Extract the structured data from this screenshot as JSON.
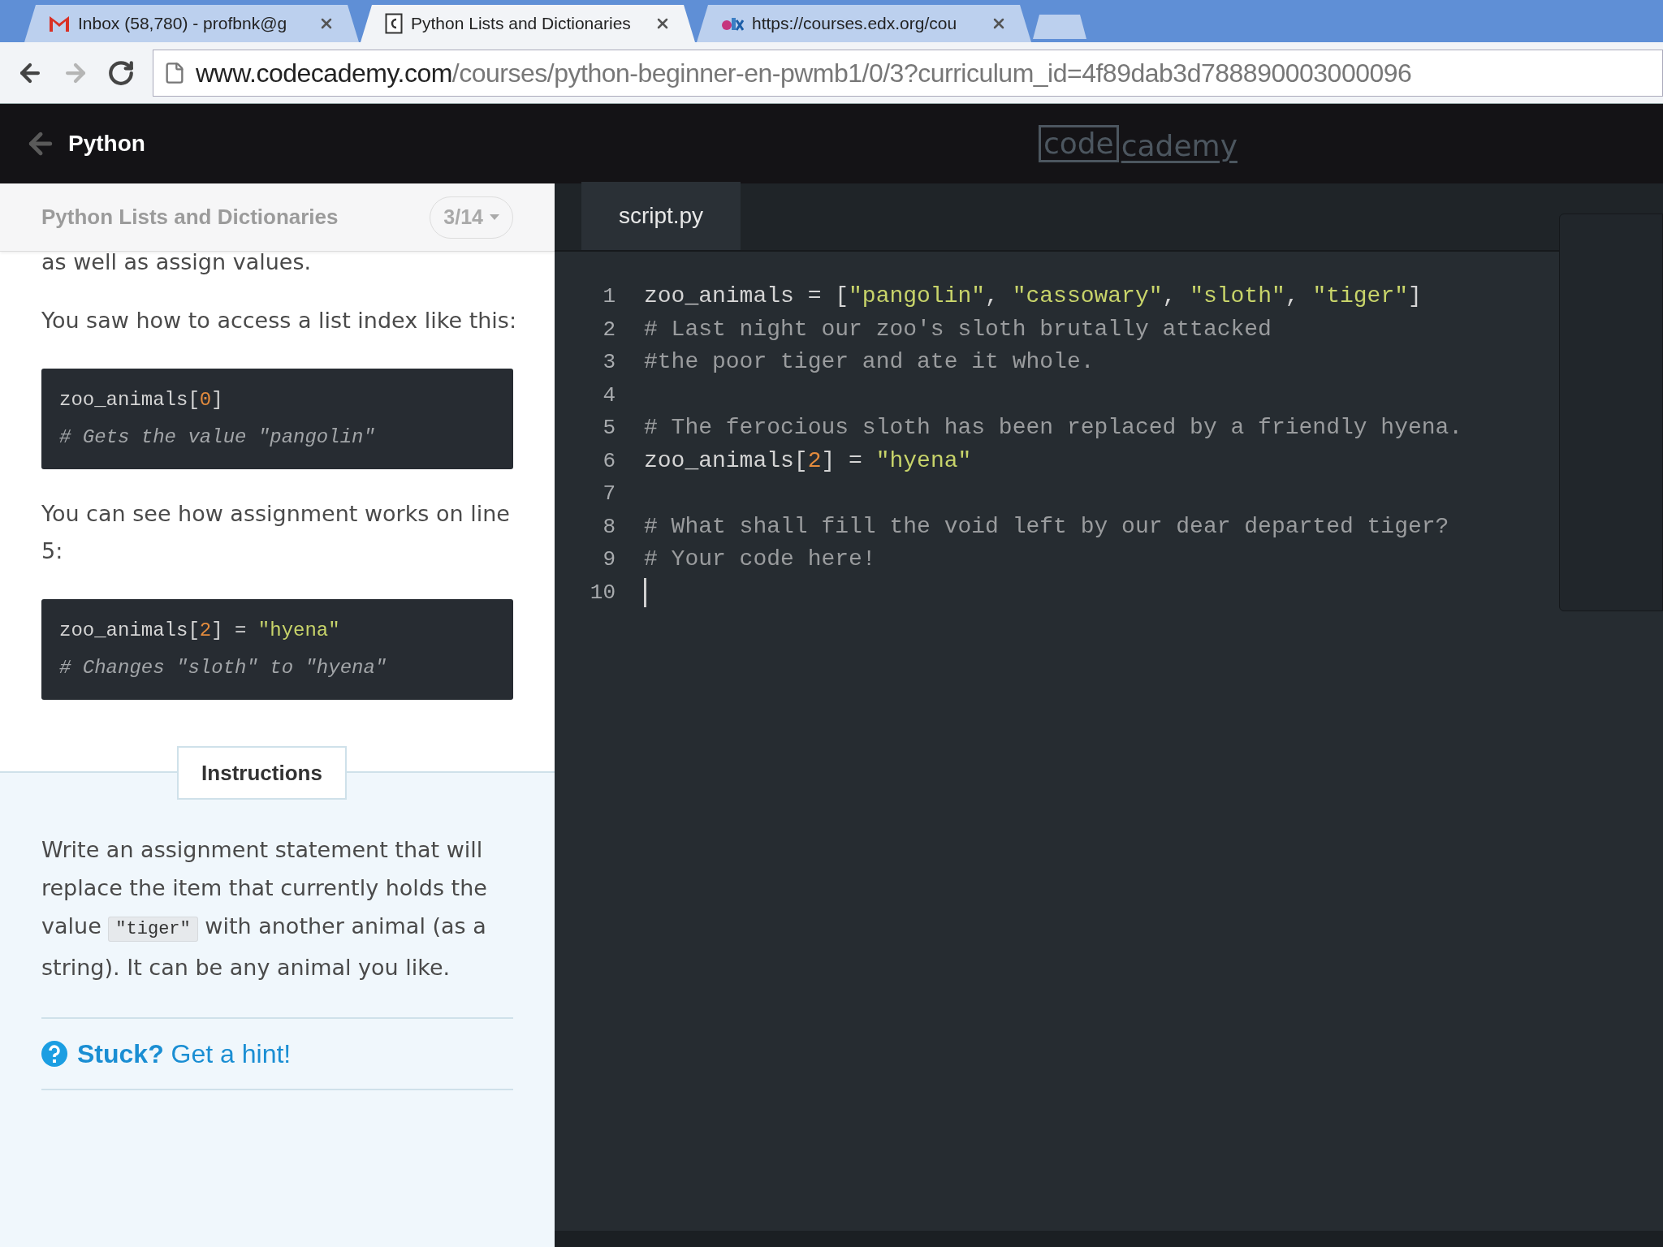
{
  "browser": {
    "tabs": [
      {
        "title": "Inbox (58,780) - profbnk@g",
        "kind": "mail",
        "selected": false
      },
      {
        "title": "Python Lists and Dictionaries",
        "kind": "page",
        "selected": true
      },
      {
        "title": "https://courses.edx.org/cou",
        "kind": "edx",
        "selected": false
      }
    ],
    "address": {
      "host": "www.codecademy.com",
      "path": "/courses/python-beginner-en-pwmb1/0/3?curriculum_id=4f89dab3d788890003000096"
    }
  },
  "header": {
    "course": "Python",
    "logo": {
      "boxed": "code",
      "rest": "cademy"
    }
  },
  "lesson": {
    "title": "Python Lists and Dictionaries",
    "progress": "3/14",
    "content": [
      {
        "kind": "cut",
        "text": "as well as assign values."
      },
      {
        "kind": "text",
        "text": "You saw how to access a list index like this:"
      },
      {
        "kind": "code",
        "lines": [
          [
            {
              "kind": "plain",
              "text": "zoo_animals["
            },
            {
              "kind": "number",
              "text": "0"
            },
            {
              "kind": "plain",
              "text": "]"
            }
          ],
          [
            {
              "kind": "comment",
              "text": "# Gets the value \"pangolin\""
            }
          ]
        ]
      },
      {
        "kind": "text",
        "text": "You can see how assignment works on line 5:"
      },
      {
        "kind": "code",
        "lines": [
          [
            {
              "kind": "plain",
              "text": "zoo_animals["
            },
            {
              "kind": "number",
              "text": "2"
            },
            {
              "kind": "plain",
              "text": "] = "
            },
            {
              "kind": "string",
              "text": "\"hyena\""
            }
          ],
          [
            {
              "kind": "comment",
              "text": "# Changes \"sloth\" to \"hyena\""
            }
          ]
        ]
      }
    ],
    "instructions": {
      "label": "Instructions",
      "parts": [
        {
          "kind": "text",
          "text": "Write an assignment statement that will replace the item that currently holds the value "
        },
        {
          "kind": "code",
          "text": "\"tiger\""
        },
        {
          "kind": "text",
          "text": " with another animal (as a string). It can be any animal you like."
        }
      ],
      "hint": {
        "lead": "Stuck?",
        "link": "Get a hint!"
      }
    }
  },
  "editor": {
    "file": "script.py",
    "lines": [
      {
        "number": "1",
        "cursor": false,
        "tokens": [
          {
            "kind": "plain",
            "text": "zoo_animals = ["
          },
          {
            "kind": "string",
            "text": "\"pangolin\""
          },
          {
            "kind": "plain",
            "text": ", "
          },
          {
            "kind": "string",
            "text": "\"cassowary\""
          },
          {
            "kind": "plain",
            "text": ", "
          },
          {
            "kind": "string",
            "text": "\"sloth\""
          },
          {
            "kind": "plain",
            "text": ", "
          },
          {
            "kind": "string",
            "text": "\"tiger\""
          },
          {
            "kind": "plain",
            "text": "]"
          }
        ]
      },
      {
        "number": "2",
        "cursor": false,
        "tokens": [
          {
            "kind": "comment",
            "text": "# Last night our zoo's sloth brutally attacked"
          }
        ]
      },
      {
        "number": "3",
        "cursor": false,
        "tokens": [
          {
            "kind": "comment",
            "text": "#the poor tiger and ate it whole."
          }
        ]
      },
      {
        "number": "4",
        "cursor": false
      },
      {
        "number": "5",
        "cursor": false,
        "tokens": [
          {
            "kind": "comment",
            "text": "# The ferocious sloth has been replaced by a friendly hyena."
          }
        ]
      },
      {
        "number": "6",
        "cursor": false,
        "tokens": [
          {
            "kind": "plain",
            "text": "zoo_animals["
          },
          {
            "kind": "number",
            "text": "2"
          },
          {
            "kind": "plain",
            "text": "] = "
          },
          {
            "kind": "string",
            "text": "\"hyena\""
          }
        ]
      },
      {
        "number": "7",
        "cursor": false
      },
      {
        "number": "8",
        "cursor": false,
        "tokens": [
          {
            "kind": "comment",
            "text": "# What shall fill the void left by our dear departed tiger?"
          }
        ]
      },
      {
        "number": "9",
        "cursor": false,
        "tokens": [
          {
            "kind": "comment",
            "text": "# Your code here!"
          }
        ]
      },
      {
        "number": "10",
        "cursor": true
      }
    ]
  }
}
